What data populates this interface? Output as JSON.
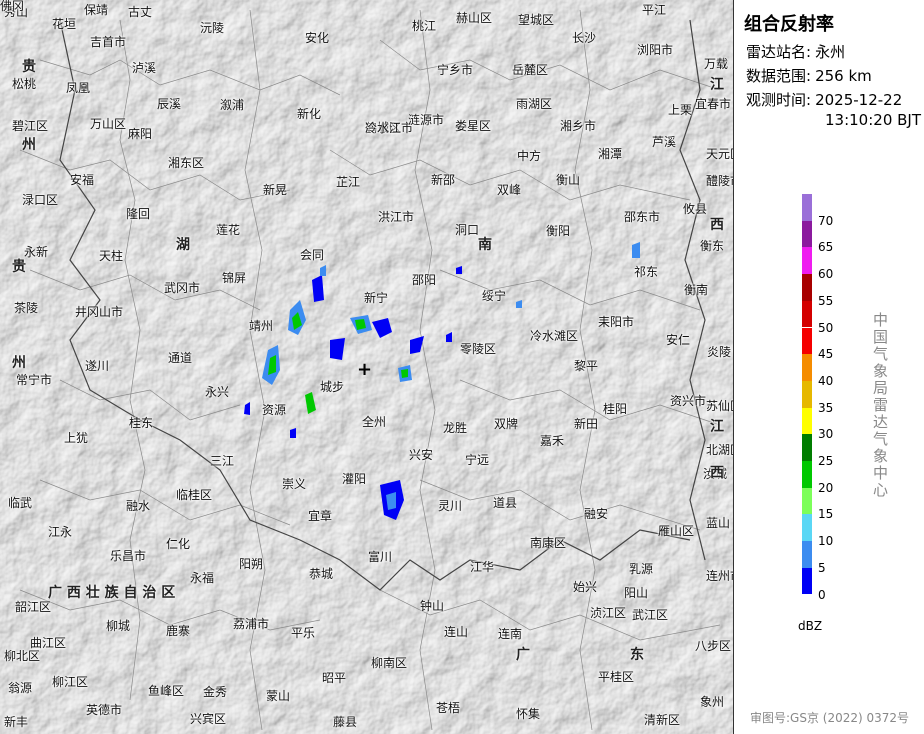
{
  "panel": {
    "title": "组合反射率",
    "station_label": "雷达站名:",
    "station_value": "永州",
    "range_label": "数据范围:",
    "range_value": "256 km",
    "time_label": "观测时间:",
    "time_date": "2025-12-22",
    "time_clock": "13:10:20 BJT",
    "legend_unit": "dBZ",
    "legend": [
      {
        "label": "70",
        "color": "#9a6fd8"
      },
      {
        "label": "65",
        "color": "#8b1a9e"
      },
      {
        "label": "60",
        "color": "#ef1df0"
      },
      {
        "label": "55",
        "color": "#a80000"
      },
      {
        "label": "50",
        "color": "#d40000"
      },
      {
        "label": "45",
        "color": "#f50000"
      },
      {
        "label": "40",
        "color": "#f58c00"
      },
      {
        "label": "35",
        "color": "#e6b800"
      },
      {
        "label": "30",
        "color": "#ffff00"
      },
      {
        "label": "25",
        "color": "#007d00"
      },
      {
        "label": "20",
        "color": "#00c800"
      },
      {
        "label": "15",
        "color": "#7cff5a"
      },
      {
        "label": "10",
        "color": "#5ad7f5"
      },
      {
        "label": "5",
        "color": "#3c8cf0"
      },
      {
        "label": "0",
        "color": "#0000f5"
      }
    ],
    "organization": "中国气象局雷达气象中心",
    "approval": "审图号:GS京 (2022) 0372号"
  },
  "map": {
    "center_marker": "+",
    "provinces": [
      {
        "id": "gui1",
        "text": "贵"
      },
      {
        "id": "zhou1",
        "text": "州"
      },
      {
        "id": "gui2",
        "text": "贵"
      },
      {
        "id": "zhou2",
        "text": "州"
      },
      {
        "id": "hu",
        "text": "湖"
      },
      {
        "id": "nan",
        "text": "南"
      },
      {
        "id": "jiang1",
        "text": "江"
      },
      {
        "id": "xi1",
        "text": "西"
      },
      {
        "id": "jiang2",
        "text": "江"
      },
      {
        "id": "xi2",
        "text": "西"
      },
      {
        "id": "guangxi",
        "text": "广 西 壮 族 自 治 区"
      },
      {
        "id": "guang",
        "text": "广"
      },
      {
        "id": "dong",
        "text": "东"
      }
    ],
    "places": [
      "秀山",
      "保靖",
      "古丈",
      "花垣",
      "吉首市",
      "沅陵",
      "安化",
      "桃江",
      "赫山区",
      "望城区",
      "长沙",
      "平江",
      "浏阳市",
      "泸溪",
      "凤凰",
      "辰溪",
      "溆浦",
      "宁乡市",
      "岳麓区",
      "万载",
      "松桃",
      "新化",
      "雨湖区",
      "宜春市",
      "上栗",
      "碧江区",
      "万山区",
      "麻阳",
      "鹤城区",
      "冷水江市",
      "涟源市",
      "娄星区",
      "湘乡市",
      "天元区",
      "芦溪",
      "湘东区",
      "中方",
      "湘潭",
      "醴陵市",
      "安福",
      "芷江",
      "新邵",
      "双峰",
      "衡山",
      "渌口区",
      "新晃",
      "隆回",
      "洪江市",
      "邵东市",
      "攸县",
      "莲花",
      "洞口",
      "衡阳",
      "衡东",
      "永新",
      "天柱",
      "会同",
      "邵阳",
      "祁东",
      "茶陵",
      "锦屏",
      "武冈市",
      "绥宁",
      "衡南",
      "井冈山市",
      "靖州",
      "新宁",
      "冷水滩区",
      "耒阳市",
      "安仁",
      "炎陵",
      "遂川",
      "通道",
      "城步",
      "零陵区",
      "常宁市",
      "黎平",
      "永兴",
      "资源",
      "全州",
      "双牌",
      "桂阳",
      "资兴市",
      "桂东",
      "龙胜",
      "新田",
      "苏仙区",
      "上犹",
      "三江",
      "兴安",
      "宁远",
      "嘉禾",
      "北湖区",
      "汝城",
      "崇义",
      "灌阳",
      "道县",
      "临武",
      "融水",
      "临桂区",
      "灵川",
      "蓝山",
      "南康区",
      "宜章",
      "江永",
      "融安",
      "雁山区",
      "乐昌市",
      "仁化",
      "永福",
      "阳朔",
      "恭城",
      "富川",
      "江华",
      "连州市",
      "始兴",
      "乳源",
      "韶江区",
      "柳城",
      "鹿寨",
      "荔浦市",
      "平乐",
      "钟山",
      "连山",
      "连南",
      "阳山",
      "浈江区",
      "武江区",
      "曲江区",
      "柳北区",
      "柳南区",
      "八步区",
      "翁源",
      "柳江区",
      "鱼峰区",
      "金秀",
      "蒙山",
      "昭平",
      "平桂区",
      "英德市",
      "象州",
      "新丰",
      "兴宾区",
      "藤县",
      "苍梧",
      "怀集",
      "清新区",
      "佛冈"
    ]
  }
}
